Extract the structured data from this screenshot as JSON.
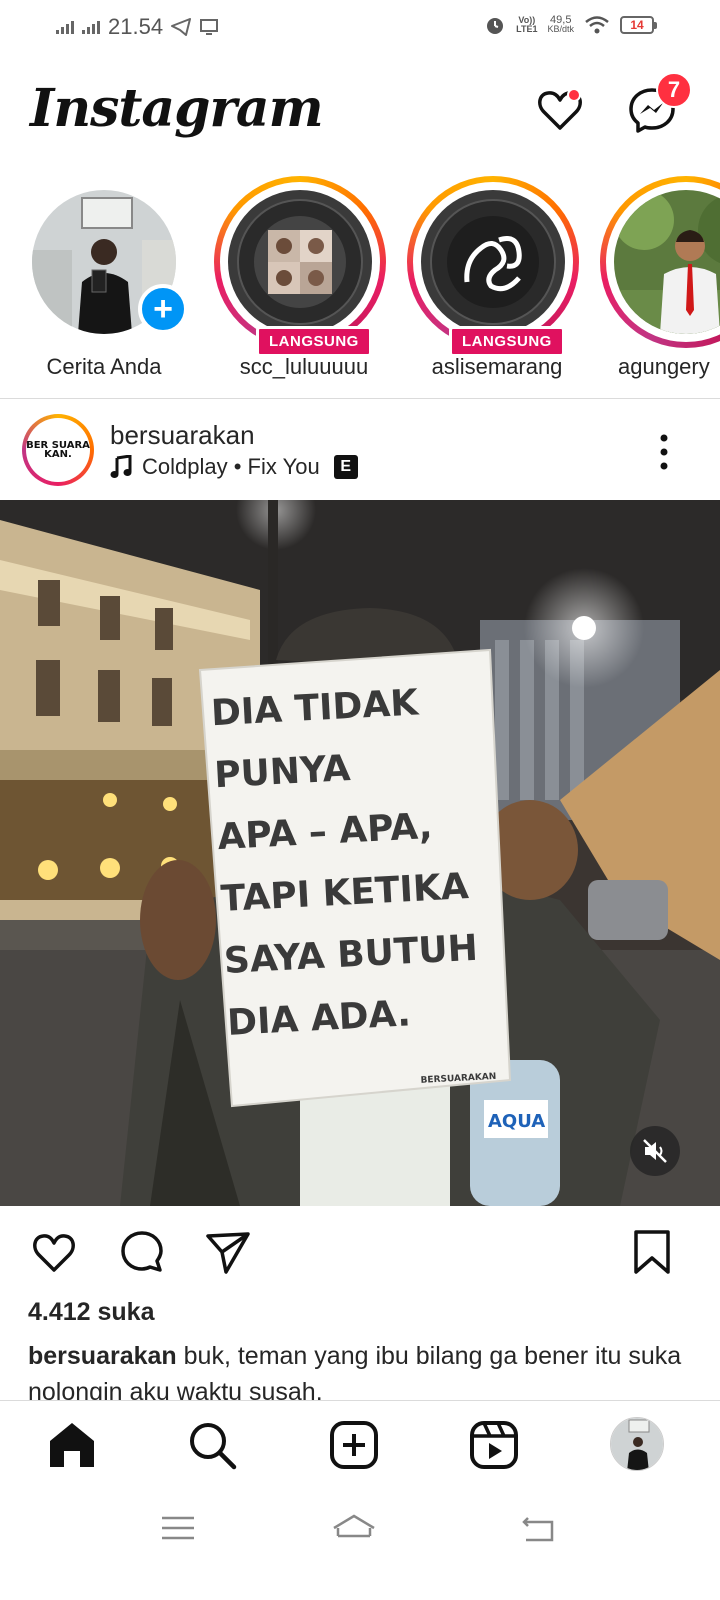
{
  "status_bar": {
    "time": "21.54",
    "volte": "Vo))",
    "lte": "LTE1",
    "data_rate_value": "49,5",
    "data_rate_unit": "KB/dtk",
    "battery": "14"
  },
  "header": {
    "logo": "Instagram",
    "messages_badge": "7"
  },
  "stories": [
    {
      "label": "Cerita Anda",
      "live": false,
      "own": true
    },
    {
      "label": "scc_luluuuuu",
      "live": true,
      "live_label": "LANGSUNG"
    },
    {
      "label": "aslisemarang",
      "live": true,
      "live_label": "LANGSUNG"
    },
    {
      "label": "agungery",
      "live": false
    }
  ],
  "post": {
    "username": "bersuarakan",
    "avatar_text": "BER SUARA KAN.",
    "music": "Coldplay • Fix You",
    "explicit_badge": "E",
    "sign_lines": [
      "DIA TIDAK",
      "PUNYA",
      "APA – APA,",
      "TAPI KETIKA",
      "SAYA BUTUH",
      "DIA ADA."
    ],
    "sign_credit": "BERSUARAKAN",
    "bottle_brand": "AQUA",
    "likes": "4.412 suka",
    "caption_user": "bersuarakan",
    "caption_text": "buk, teman yang ibu bilang ga bener itu suka nolongin aku waktu susah."
  },
  "colors": {
    "accent_blue": "#0095f6",
    "notification_red": "#ff3040",
    "live_pink": "#e0115f"
  }
}
